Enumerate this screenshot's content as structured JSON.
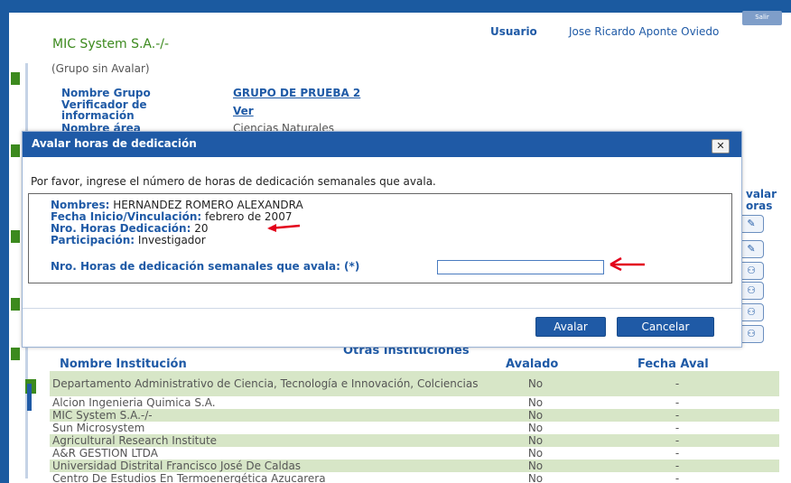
{
  "header": {
    "exit_label": "Salir",
    "user_label": "Usuario",
    "user_name": "Jose Ricardo Aponte Oviedo",
    "company": "MIC System S.A.-/-"
  },
  "group": {
    "status": "(Grupo sin Avalar)",
    "name_label": "Nombre Grupo",
    "name_value": "GRUPO DE PRUEBA 2",
    "verifier_label_1": "Verificador de",
    "verifier_label_2": "información",
    "verifier_value": "Ver",
    "area_label": "Nombre área",
    "area_value": "Ciencias Naturales"
  },
  "right_column": {
    "header_1": "valar",
    "header_2": "oras"
  },
  "dialog": {
    "title": "Avalar horas de dedicación",
    "close_label": "✕",
    "message": "Por favor, ingrese el número de horas de dedicación semanales que avala.",
    "names_label": "Nombres:",
    "names_value": "HERNANDEZ ROMERO ALEXANDRA",
    "start_label": "Fecha Inicio/Vinculación:",
    "start_value": "febrero de 2007",
    "hours_label": "Nro. Horas Dedicación:",
    "hours_value": "20",
    "participation_label": "Participación:",
    "participation_value": "Investigador",
    "avala_label": "Nro. Horas de dedicación semanales que avala: (*)",
    "avala_value": "",
    "submit_label": "Avalar",
    "cancel_label": "Cancelar"
  },
  "institutions": {
    "section_title": "Otras Instituciones",
    "col_name": "Nombre Institución",
    "col_endorsed": "Avalado",
    "col_date": "Fecha Aval",
    "rows": [
      {
        "name": "Departamento Administrativo de Ciencia, Tecnología e Innovación, Colciencias",
        "endorsed": "No",
        "date": "-"
      },
      {
        "name": "Alcion Ingenieria Quimica S.A.",
        "endorsed": "No",
        "date": "-"
      },
      {
        "name": "MIC System S.A.-/-",
        "endorsed": "No",
        "date": "-"
      },
      {
        "name": "Sun Microsystem",
        "endorsed": "No",
        "date": "-"
      },
      {
        "name": "Agricultural Research Institute",
        "endorsed": "No",
        "date": "-"
      },
      {
        "name": "A&R GESTION LTDA",
        "endorsed": "No",
        "date": "-"
      },
      {
        "name": "Universidad Distrital Francisco José De Caldas",
        "endorsed": "No",
        "date": "-"
      },
      {
        "name": "Centro De Estudios En Termoenergética Azucarera",
        "endorsed": "No",
        "date": "-"
      }
    ]
  },
  "colors": {
    "primary": "#1f5aa6",
    "green": "#3c8a1e",
    "row_alt": "#d7e6c7",
    "annotation_arrow": "#e3001b"
  }
}
